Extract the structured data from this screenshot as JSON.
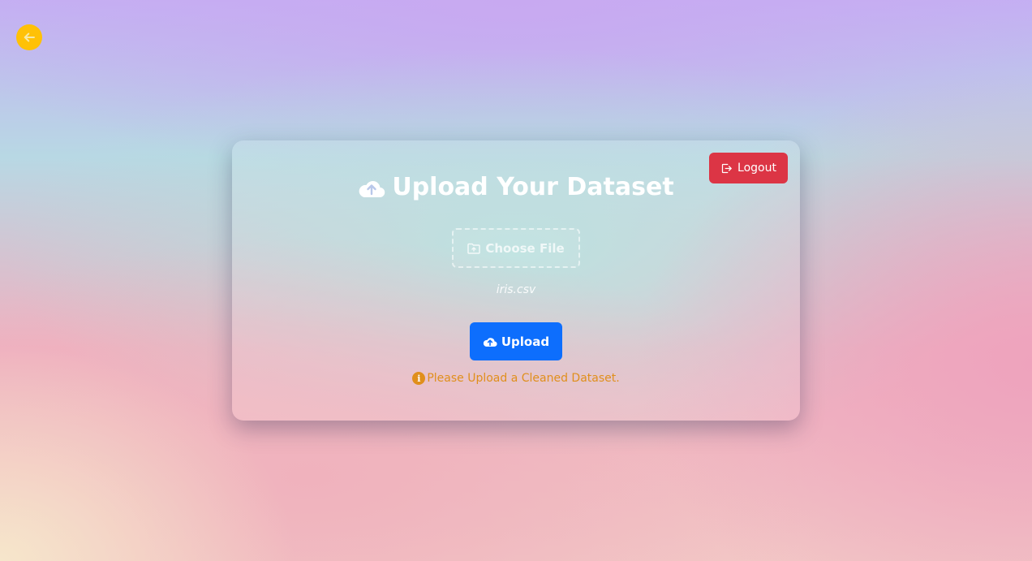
{
  "back": {
    "icon": "arrow-left-icon"
  },
  "card": {
    "title": "Upload Your Dataset",
    "title_icon": "cloud-upload-icon",
    "logout_label": "Logout",
    "logout_icon": "logout-icon",
    "choose_file_label": "Choose File",
    "choose_file_icon": "folder-icon",
    "file_name": "iris.csv",
    "upload_label": "Upload",
    "upload_icon": "cloud-upload-icon",
    "warning_text": "Please Upload a Cleaned Dataset.",
    "warning_icon": "info-icon"
  },
  "colors": {
    "back_button": "#ffc107",
    "logout_button": "#dc3545",
    "upload_button": "#0d6efd",
    "warning_text": "#e08f1c"
  }
}
